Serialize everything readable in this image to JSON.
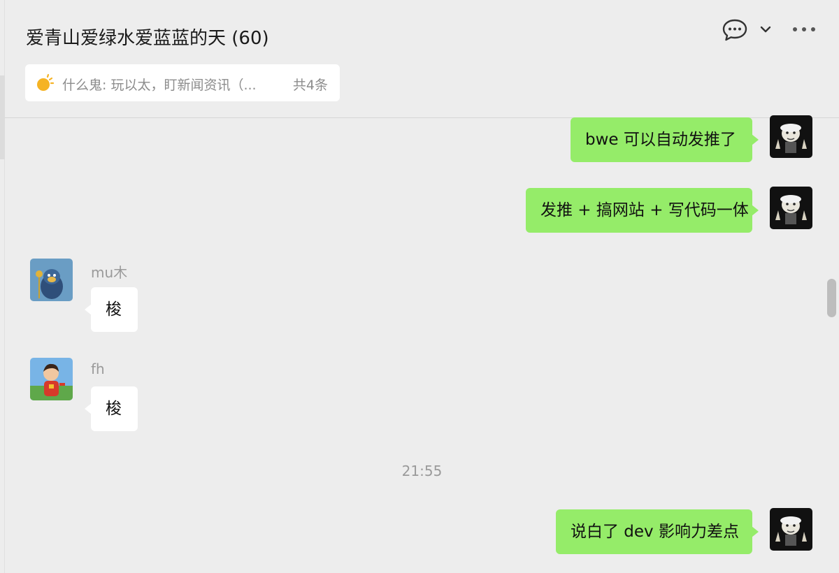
{
  "chat": {
    "title": "爱青山爱绿水爱蓝蓝的天 (60)",
    "pinned_text": "什么鬼: 玩以太，盯新闻资讯（...",
    "pinned_count": "共4条"
  },
  "icons": {
    "chat": "speech-bubble-icon",
    "dropdown": "chevron-down-icon",
    "more": "more-dots-icon",
    "pinned": "bulb-icon"
  },
  "messages": [
    {
      "side": "me",
      "text": "bwe 可以自动发推了"
    },
    {
      "side": "me",
      "text": "发推 + 搞网站 + 写代码一体"
    },
    {
      "side": "other",
      "sender": "mu木",
      "text": "梭"
    },
    {
      "side": "other",
      "sender": "fh",
      "text": "梭"
    },
    {
      "time": "21:55"
    },
    {
      "side": "me",
      "text": "说白了 dev 影响力差点"
    }
  ],
  "colors": {
    "background": "#ededed",
    "my_bubble": "#95ec69",
    "other_bubble": "#ffffff",
    "muted_text": "#9a9a9a"
  }
}
